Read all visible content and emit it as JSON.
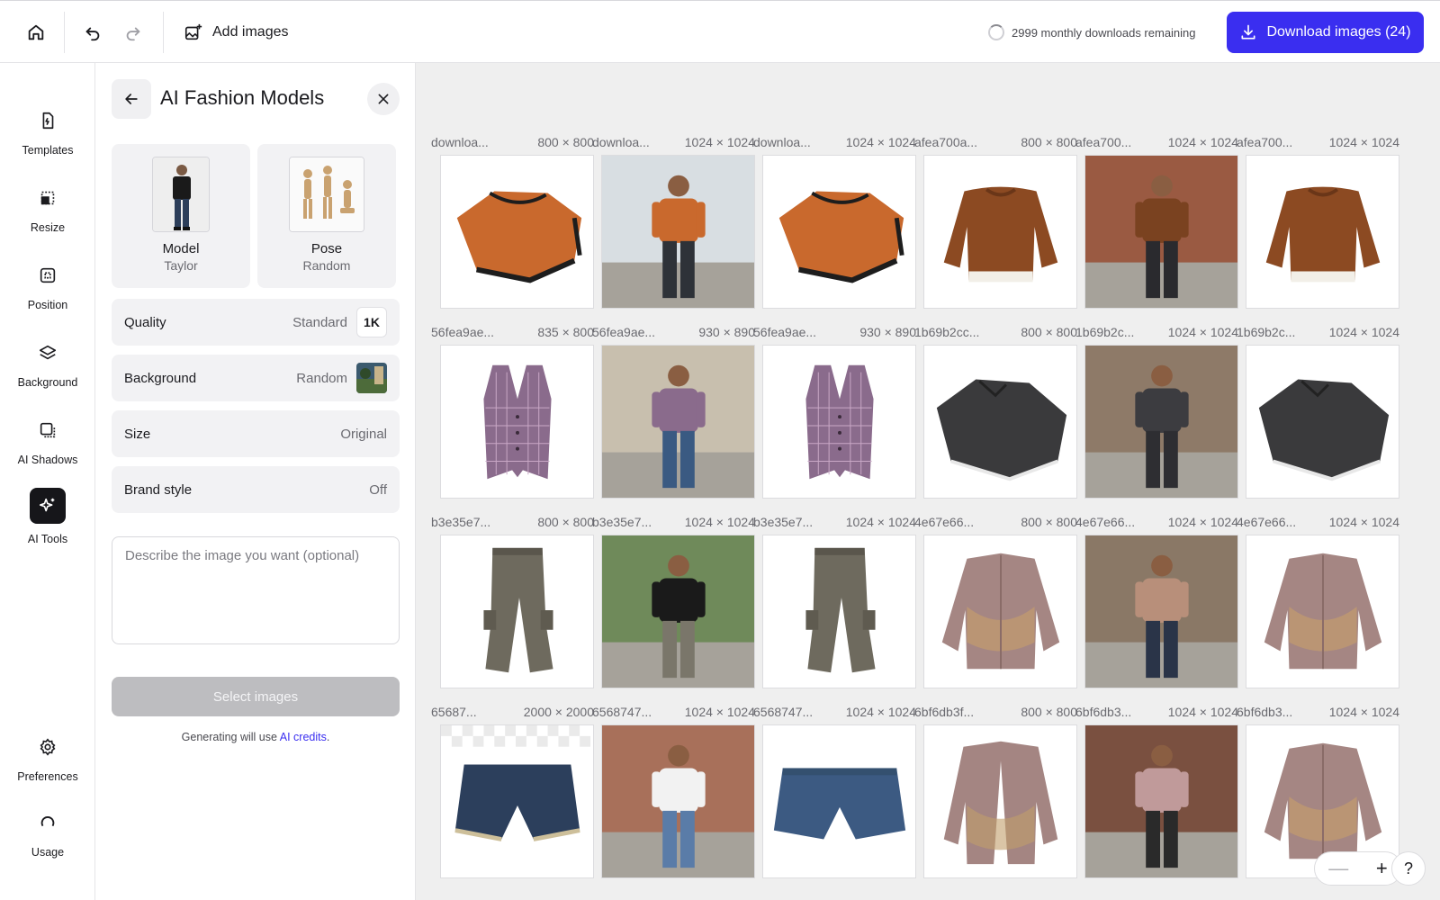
{
  "topbar": {
    "add_images_label": "Add images",
    "downloads_remaining": "2999 monthly downloads remaining",
    "download_button_label": "Download images (24)"
  },
  "rail": {
    "items": [
      {
        "label": "Templates",
        "icon": "templates-icon"
      },
      {
        "label": "Resize",
        "icon": "resize-icon"
      },
      {
        "label": "Position",
        "icon": "position-icon"
      },
      {
        "label": "Background",
        "icon": "layers-icon"
      },
      {
        "label": "AI Shadows",
        "icon": "shadows-icon"
      },
      {
        "label": "AI Tools",
        "icon": "sparkle-icon",
        "active": true
      }
    ],
    "bottom_items": [
      {
        "label": "Preferences",
        "icon": "gear-icon"
      },
      {
        "label": "Usage",
        "icon": "usage-icon"
      }
    ]
  },
  "panel": {
    "title": "AI Fashion Models",
    "model": {
      "label": "Model",
      "value": "Taylor"
    },
    "pose": {
      "label": "Pose",
      "value": "Random"
    },
    "options": [
      {
        "key": "Quality",
        "value": "Standard",
        "badge": "1K"
      },
      {
        "key": "Background",
        "value": "Random"
      },
      {
        "key": "Size",
        "value": "Original"
      },
      {
        "key": "Brand style",
        "value": "Off"
      }
    ],
    "prompt_placeholder": "Describe the image you want (optional)",
    "select_button_label": "Select images",
    "note_prefix": "Generating will use ",
    "note_link": "AI credits",
    "note_suffix": "."
  },
  "gallery": {
    "rows": [
      [
        {
          "name": "downloa...",
          "dims": "800 × 800",
          "kind": "sweater-orange"
        },
        {
          "name": "downloa...",
          "dims": "1024 × 1024",
          "kind": "model-orange"
        },
        {
          "name": "downloa...",
          "dims": "1024 × 1024",
          "kind": "sweater-orange"
        },
        {
          "name": "afea700a...",
          "dims": "800 × 800",
          "kind": "sweater-brown"
        },
        {
          "name": "afea700...",
          "dims": "1024 × 1024",
          "kind": "model-brown"
        },
        {
          "name": "afea700...",
          "dims": "1024 × 1024",
          "kind": "sweater-brown"
        }
      ],
      [
        {
          "name": "56fea9ae...",
          "dims": "835 × 800",
          "kind": "vest"
        },
        {
          "name": "56fea9ae...",
          "dims": "930 × 890",
          "kind": "model-vest"
        },
        {
          "name": "56fea9ae...",
          "dims": "930 × 890",
          "kind": "vest"
        },
        {
          "name": "1b69b2cc...",
          "dims": "800 × 800",
          "kind": "sweater-gray"
        },
        {
          "name": "1b69b2c...",
          "dims": "1024 × 1024",
          "kind": "model-gray"
        },
        {
          "name": "1b69b2c...",
          "dims": "1024 × 1024",
          "kind": "sweater-gray"
        }
      ],
      [
        {
          "name": "b3e35e7...",
          "dims": "800 × 800",
          "kind": "pants"
        },
        {
          "name": "b3e35e7...",
          "dims": "1024 × 1024",
          "kind": "model-pants"
        },
        {
          "name": "b3e35e7...",
          "dims": "1024 × 1024",
          "kind": "pants"
        },
        {
          "name": "4e67e66...",
          "dims": "800 × 800",
          "kind": "jacket"
        },
        {
          "name": "4e67e66...",
          "dims": "1024 × 1024",
          "kind": "model-jacket"
        },
        {
          "name": "4e67e66...",
          "dims": "1024 × 1024",
          "kind": "jacket"
        }
      ],
      [
        {
          "name": "65687...",
          "dims": "2000 × 2000",
          "kind": "shorts"
        },
        {
          "name": "6568747...",
          "dims": "1024 × 1024",
          "kind": "model-shorts"
        },
        {
          "name": "6568747...",
          "dims": "1024 × 1024",
          "kind": "shorts-plain"
        },
        {
          "name": "6bf6db3f...",
          "dims": "800 × 800",
          "kind": "jacket-open"
        },
        {
          "name": "6bf6db3...",
          "dims": "1024 × 1024",
          "kind": "model-jacket2"
        },
        {
          "name": "6bf6db3...",
          "dims": "1024 × 1024",
          "kind": "jacket"
        }
      ]
    ]
  },
  "zoom": {
    "minus": "—",
    "plus": "+"
  },
  "help_label": "?",
  "colors": {
    "accent": "#3a2ef0",
    "disabled": "#bdbdc0"
  }
}
